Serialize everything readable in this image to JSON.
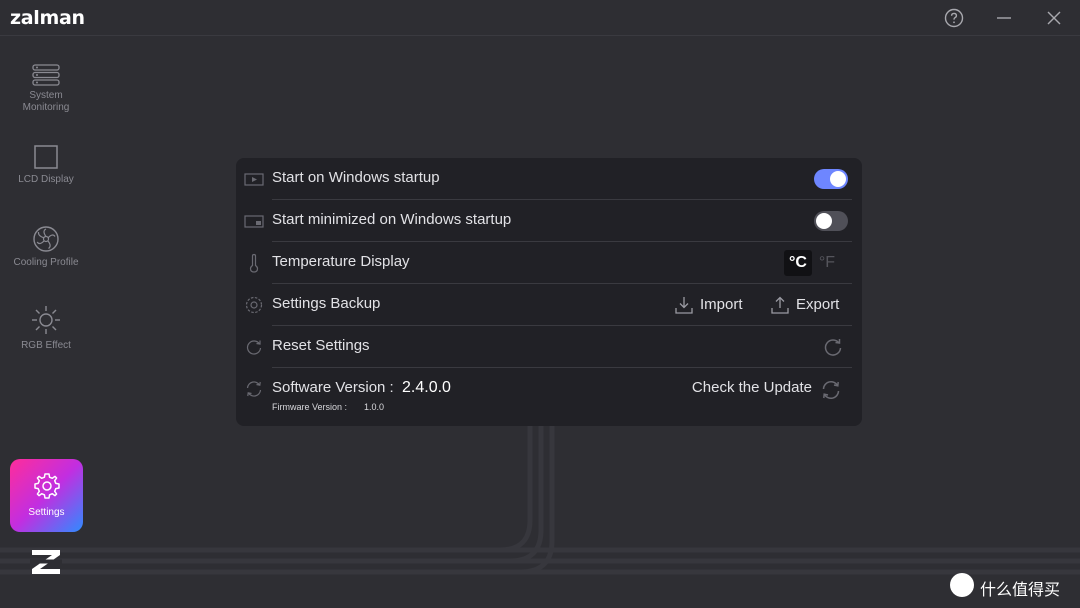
{
  "app": {
    "brand": "zalman"
  },
  "sidebar": {
    "items": [
      {
        "label": "System Monitoring",
        "icon": "system-monitoring-icon"
      },
      {
        "label": "LCD Display",
        "icon": "lcd-display-icon"
      },
      {
        "label": "Cooling Profile",
        "icon": "cooling-fan-icon"
      },
      {
        "label": "RGB Effect",
        "icon": "sun-icon"
      },
      {
        "label": "Settings",
        "icon": "gear-icon",
        "active": true
      }
    ]
  },
  "settings": {
    "startup": {
      "label": "Start on Windows startup",
      "enabled": true
    },
    "minimized": {
      "label": "Start minimized on Windows startup",
      "enabled": false
    },
    "temperature": {
      "label": "Temperature Display",
      "unit_c": "°C",
      "unit_f": "°F",
      "selected": "°C"
    },
    "backup": {
      "label": "Settings Backup",
      "import_label": "Import",
      "export_label": "Export"
    },
    "reset": {
      "label": "Reset Settings"
    },
    "version": {
      "label": "Software Version :",
      "value": "2.4.0.0",
      "firmware_label": "Firmware Version :",
      "firmware_value": "1.0.0",
      "check_update_label": "Check the Update"
    }
  },
  "watermark": {
    "text": "什么值得买"
  },
  "colors": {
    "background": "#2e2e33",
    "panel": "#212126",
    "toggle_on": "#6e86ff",
    "toggle_off": "#505058",
    "settings_gradient_start": "#ff2d9a",
    "settings_gradient_end": "#2f8cff"
  }
}
